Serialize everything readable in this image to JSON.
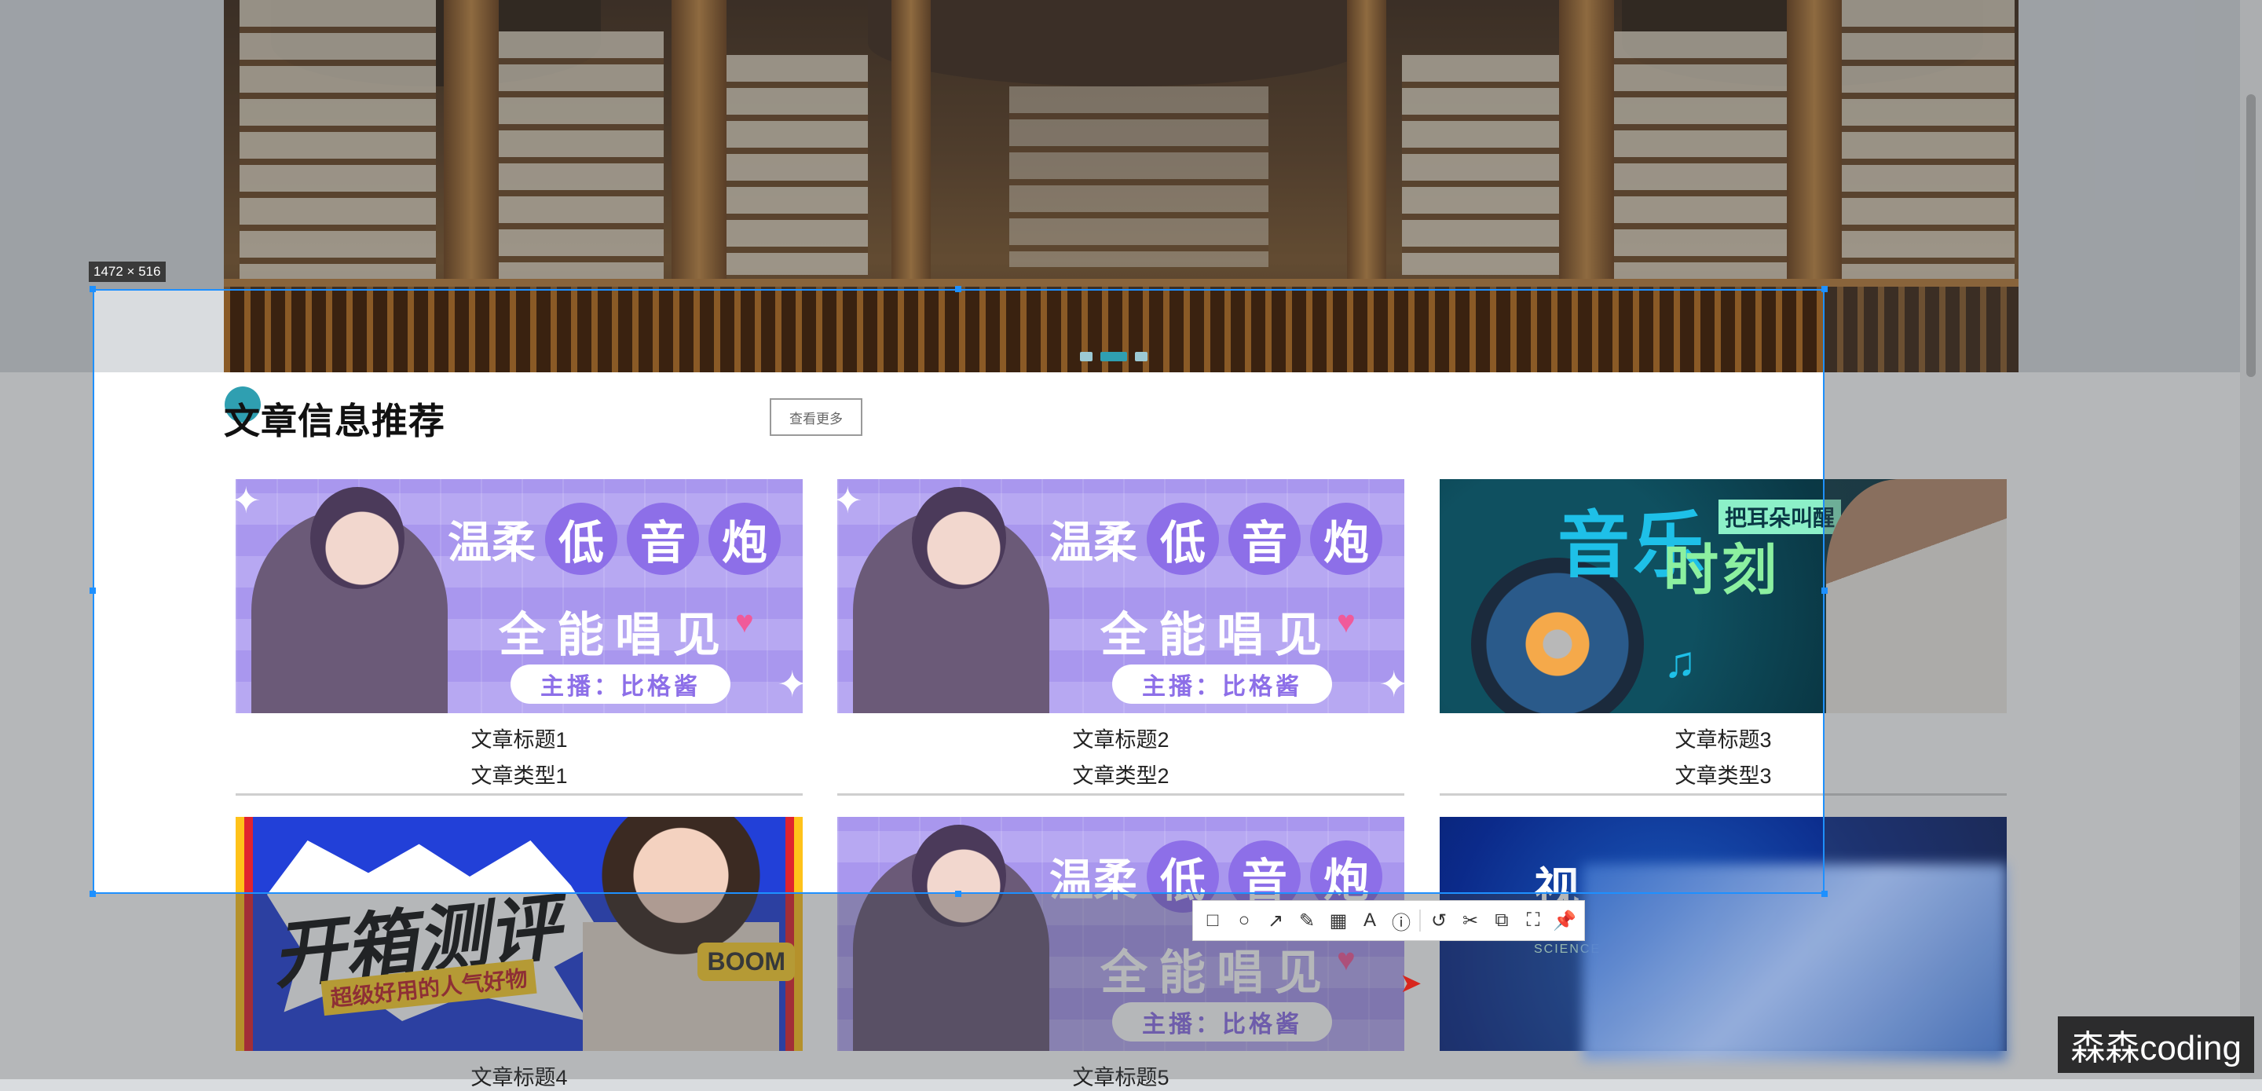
{
  "selection": {
    "size_label": "1472 × 516"
  },
  "carousel": {
    "slides": 3,
    "active_index": 1
  },
  "section": {
    "title": "文章信息推荐",
    "more_label": "查看更多"
  },
  "articles": [
    {
      "title": "文章标题1",
      "type": "文章类型1",
      "banner": "purple"
    },
    {
      "title": "文章标题2",
      "type": "文章类型2",
      "banner": "purple"
    },
    {
      "title": "文章标题3",
      "type": "文章类型3",
      "banner": "music"
    },
    {
      "title": "文章标题4",
      "type": "",
      "banner": "unbox"
    },
    {
      "title": "文章标题5",
      "type": "",
      "banner": "purple"
    },
    {
      "title": "",
      "type": "",
      "banner": "science"
    }
  ],
  "banners": {
    "purple": {
      "line1_a": "温柔",
      "line1_b": [
        "低",
        "音",
        "炮"
      ],
      "line2": "全能唱见",
      "pill": "主播：比格酱"
    },
    "music": {
      "big1": "音乐",
      "big2": "时刻",
      "tag": "把耳朵叫醒"
    },
    "unbox": {
      "main": "开箱测评",
      "sub": "超级好用的人气好物",
      "badge": "BOOM"
    },
    "science": {
      "title": "视",
      "subtitle": "SCIENCE"
    }
  },
  "toolbar": {
    "tools": [
      "rect-icon",
      "ellipse-icon",
      "arrow-icon",
      "pencil-icon",
      "mosaic-icon",
      "text-icon",
      "serial-icon",
      "undo-icon",
      "cut-icon",
      "copy-icon",
      "fullscreen-icon",
      "pin-icon"
    ]
  },
  "watermark": "森森coding",
  "colors": {
    "accent": "#2f9fb1",
    "selection": "#1e90ff"
  }
}
